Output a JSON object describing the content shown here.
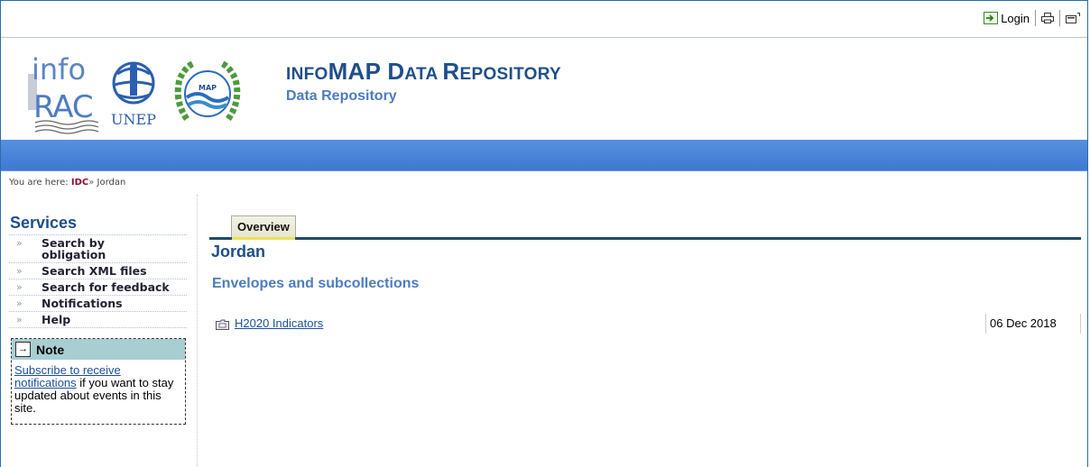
{
  "toolbar": {
    "login_label": "Login"
  },
  "header": {
    "logo_info_top": "info",
    "logo_info_bottom": "RAC",
    "logo_unep": "UNEP",
    "logo_map": "MAP",
    "title_prefix_small": "INFO",
    "title_big1": "MAP ",
    "title_d": "D",
    "title_ata": "ATA ",
    "title_r": "R",
    "title_epository": "EPOSITORY",
    "subtitle": "Data Repository"
  },
  "breadcrumb": {
    "prefix": "You are here:",
    "home": "IDC",
    "separator": "»",
    "current": "Jordan"
  },
  "sidebar": {
    "services_title": "Services",
    "bullet": "»",
    "items": [
      {
        "label": "Search by obligation"
      },
      {
        "label": "Search XML files"
      },
      {
        "label": "Search for feedback"
      },
      {
        "label": "Notifications"
      },
      {
        "label": "Help"
      }
    ],
    "note": {
      "title": "Note",
      "link_text": "Subscribe to receive notifications",
      "body_text": " if you want to stay updated about events in this site."
    }
  },
  "main": {
    "tabs": [
      {
        "label": "Overview"
      }
    ],
    "title": "Jordan",
    "section_title": "Envelopes and subcollections",
    "rows": [
      {
        "name": "H2020 Indicators",
        "date": "06 Dec 2018"
      }
    ]
  },
  "colors": {
    "title_blue": "#1f4f8b",
    "subtitle_blue": "#4d7cc2",
    "band_blue": "#4a85d8",
    "note_head": "#a8ced2",
    "breadcrumb_home": "#8b0a38"
  }
}
